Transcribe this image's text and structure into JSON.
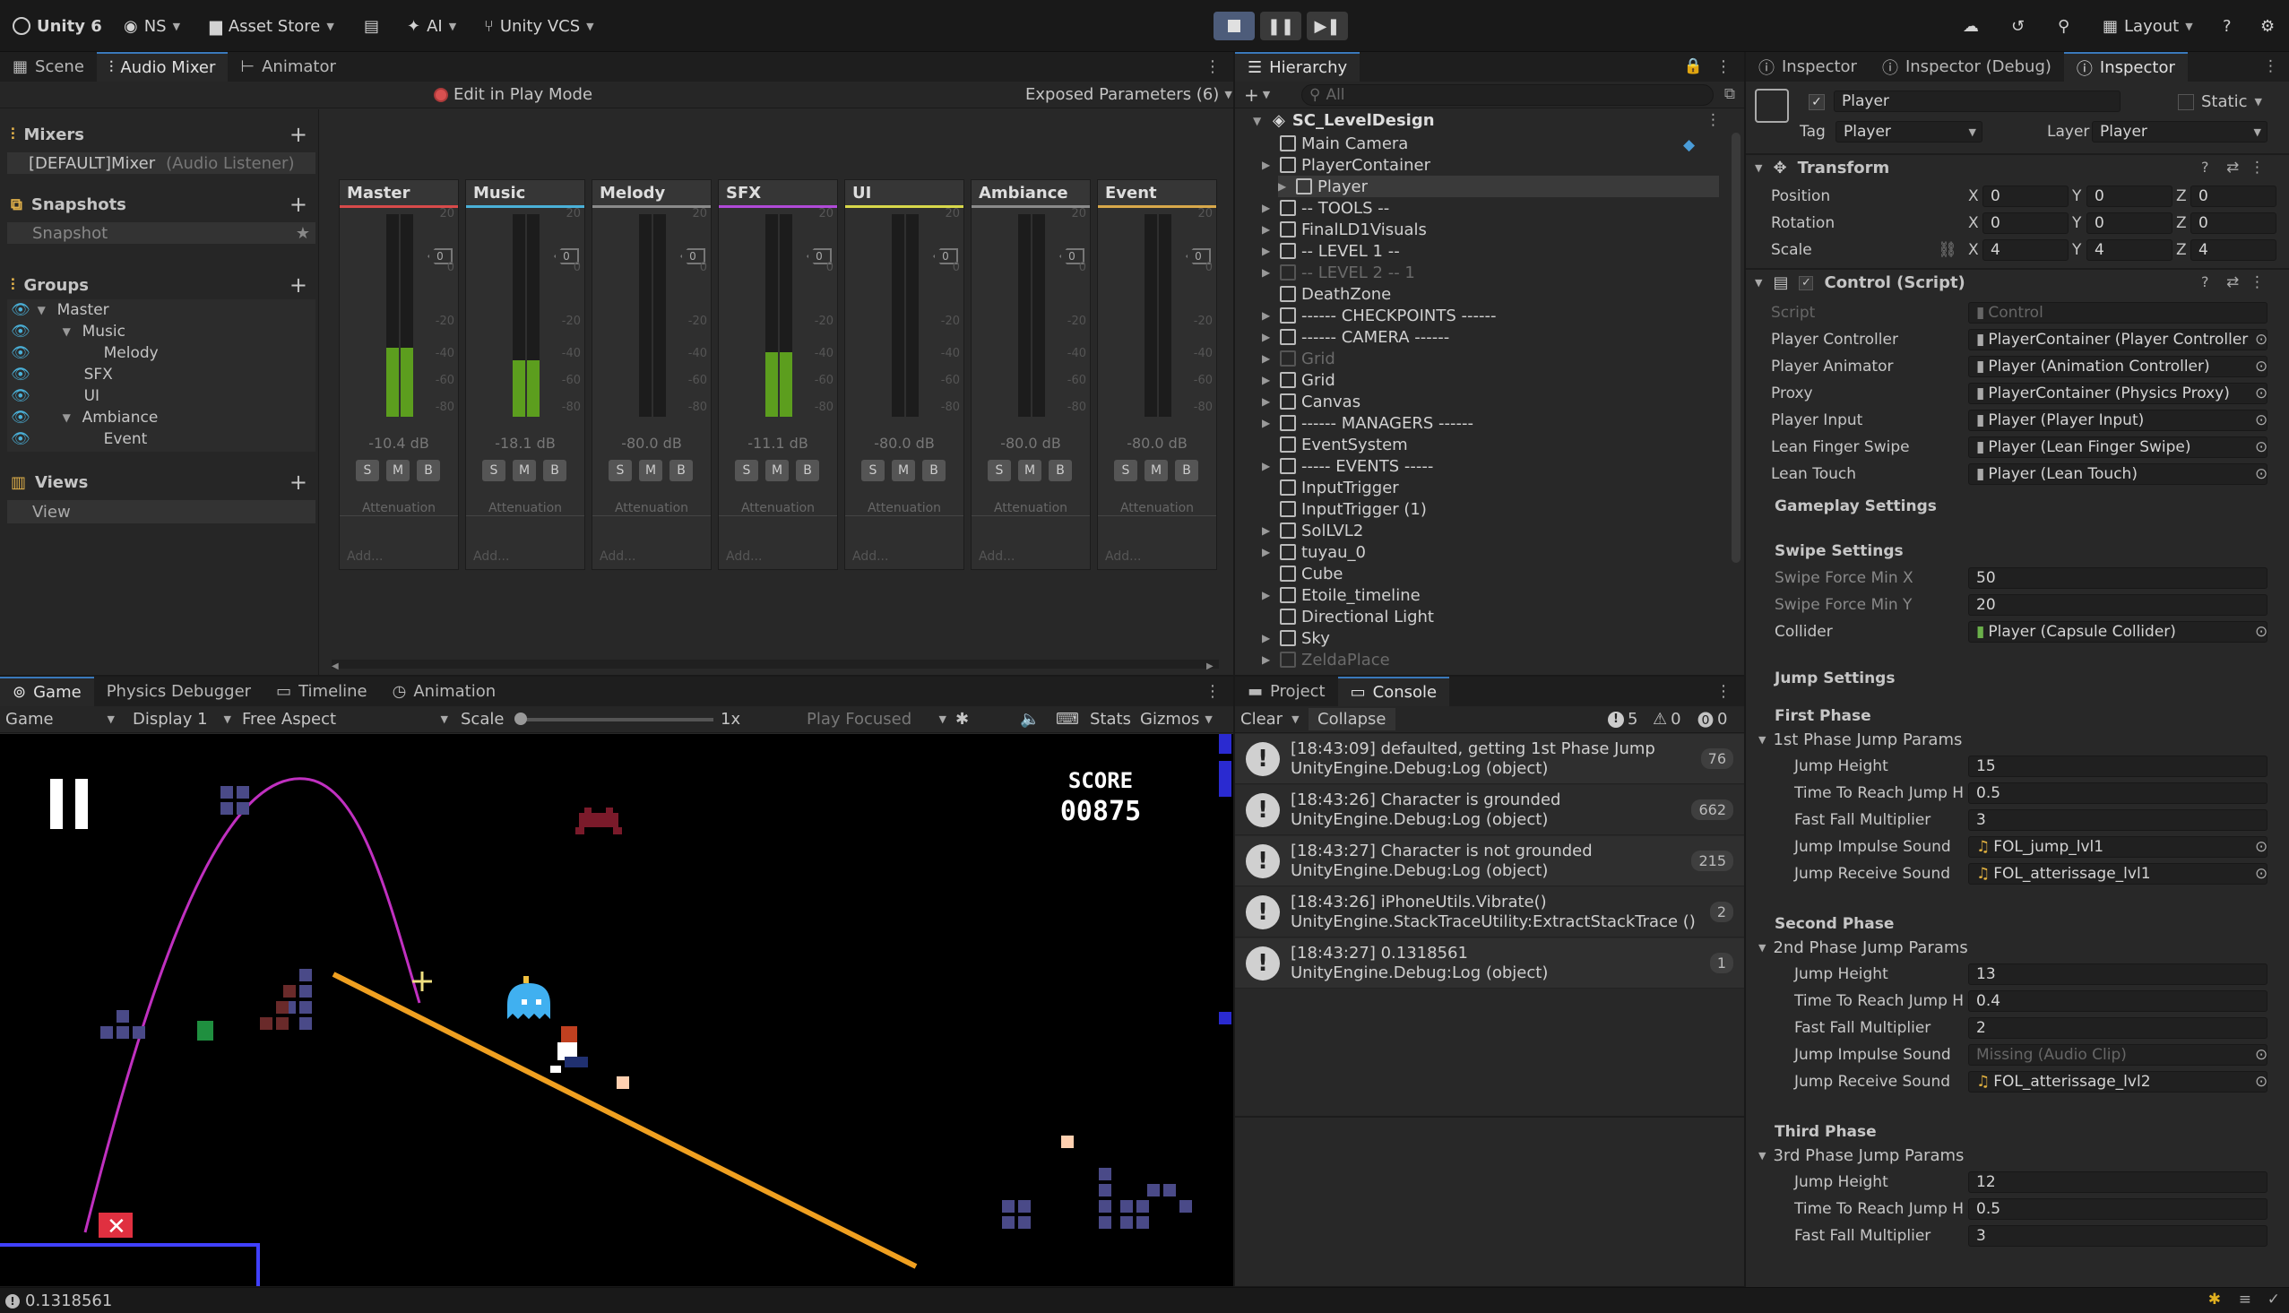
{
  "toolbar": {
    "app": "Unity 6",
    "account": "NS",
    "asset_store": "Asset Store",
    "ai": "AI",
    "vcs": "Unity VCS",
    "layout": "Layout"
  },
  "mixer_panel": {
    "tabs": [
      "Scene",
      "Audio Mixer",
      "Animator"
    ],
    "edit_play": "Edit in Play Mode",
    "exposed": "Exposed Parameters (6)",
    "mixers_title": "Mixers",
    "mixer_item": "[DEFAULT]Mixer",
    "mixer_item_note": "(Audio Listener)",
    "snapshots_title": "Snapshots",
    "snapshot_item": "Snapshot",
    "groups_title": "Groups",
    "groups": [
      "Master",
      "Music",
      "Melody",
      "SFX",
      "UI",
      "Ambiance",
      "Event"
    ],
    "views_title": "Views",
    "view_item": "View",
    "strips": [
      {
        "name": "Master",
        "db": "-10.4 dB",
        "level": 0.34,
        "color": "#d84a4a"
      },
      {
        "name": "Music",
        "db": "-18.1 dB",
        "level": 0.28,
        "color": "#4ab0d8"
      },
      {
        "name": "Melody",
        "db": "-80.0 dB",
        "level": 0.0,
        "color": "#8a8a8a"
      },
      {
        "name": "SFX",
        "db": "-11.1 dB",
        "level": 0.32,
        "color": "#b04ad8"
      },
      {
        "name": "UI",
        "db": "-80.0 dB",
        "level": 0.0,
        "color": "#d8d84a"
      },
      {
        "name": "Ambiance",
        "db": "-80.0 dB",
        "level": 0.0,
        "color": "#8a8a8a"
      },
      {
        "name": "Event",
        "db": "-80.0 dB",
        "level": 0.0,
        "color": "#d8a84a"
      }
    ],
    "scale_labels": [
      "20",
      "0",
      "-20",
      "-40",
      "-60",
      "-80"
    ],
    "fader_value": "0",
    "smb": [
      "S",
      "M",
      "B"
    ],
    "attenuation": "Attenuation",
    "add": "Add..."
  },
  "hierarchy": {
    "tab": "Hierarchy",
    "search_placeholder": "All",
    "scene": "SC_LevelDesign",
    "items": [
      {
        "name": "Main Camera",
        "indent": 0,
        "arrow": false,
        "dim": false
      },
      {
        "name": "PlayerContainer",
        "indent": 0,
        "arrow": true,
        "dim": false
      },
      {
        "name": "Player",
        "indent": 1,
        "arrow": true,
        "dim": false
      },
      {
        "name": "-- TOOLS --",
        "indent": 0,
        "arrow": true,
        "dim": false
      },
      {
        "name": "FinalLD1Visuals",
        "indent": 0,
        "arrow": true,
        "dim": false
      },
      {
        "name": "-- LEVEL 1 --",
        "indent": 0,
        "arrow": true,
        "dim": false
      },
      {
        "name": "-- LEVEL 2 -- 1",
        "indent": 0,
        "arrow": true,
        "dim": true
      },
      {
        "name": "DeathZone",
        "indent": 0,
        "arrow": false,
        "dim": false
      },
      {
        "name": "------ CHECKPOINTS ------",
        "indent": 0,
        "arrow": true,
        "dim": false
      },
      {
        "name": "------ CAMERA ------",
        "indent": 0,
        "arrow": true,
        "dim": false
      },
      {
        "name": "Grid",
        "indent": 0,
        "arrow": true,
        "dim": true
      },
      {
        "name": "Grid",
        "indent": 0,
        "arrow": true,
        "dim": false
      },
      {
        "name": "Canvas",
        "indent": 0,
        "arrow": true,
        "dim": false
      },
      {
        "name": "------ MANAGERS ------",
        "indent": 0,
        "arrow": true,
        "dim": false
      },
      {
        "name": "EventSystem",
        "indent": 0,
        "arrow": false,
        "dim": false
      },
      {
        "name": "----- EVENTS -----",
        "indent": 0,
        "arrow": true,
        "dim": false
      },
      {
        "name": "InputTrigger",
        "indent": 0,
        "arrow": false,
        "dim": false
      },
      {
        "name": "InputTrigger (1)",
        "indent": 0,
        "arrow": false,
        "dim": false
      },
      {
        "name": "SolLVL2",
        "indent": 0,
        "arrow": true,
        "dim": false
      },
      {
        "name": "tuyau_0",
        "indent": 0,
        "arrow": true,
        "dim": false
      },
      {
        "name": "Cube",
        "indent": 0,
        "arrow": false,
        "dim": false
      },
      {
        "name": "Etoile_timeline",
        "indent": 0,
        "arrow": true,
        "dim": false
      },
      {
        "name": "Directional Light",
        "indent": 0,
        "arrow": false,
        "dim": false
      },
      {
        "name": "Sky",
        "indent": 0,
        "arrow": true,
        "dim": false
      },
      {
        "name": "ZeldaPlace",
        "indent": 0,
        "arrow": true,
        "dim": true
      }
    ]
  },
  "game": {
    "tabs": [
      "Game",
      "Physics Debugger",
      "Timeline",
      "Animation"
    ],
    "mode": "Game",
    "display": "Display 1",
    "aspect": "Free Aspect",
    "scale_label": "Scale",
    "scale_value": "1x",
    "play_focused": "Play Focused",
    "stats": "Stats",
    "gizmos": "Gizmos",
    "score_label": "SCORE",
    "score_value": "00875"
  },
  "console": {
    "tabs": [
      "Project",
      "Console"
    ],
    "clear": "Clear",
    "collapse": "Collapse",
    "counts": [
      "5",
      "0",
      "0"
    ],
    "logs": [
      {
        "l1": "[18:43:09] defaulted, getting 1st Phase Jump",
        "l2": "UnityEngine.Debug:Log (object)",
        "count": "76"
      },
      {
        "l1": "[18:43:26] Character is grounded",
        "l2": "UnityEngine.Debug:Log (object)",
        "count": "662"
      },
      {
        "l1": "[18:43:27] Character is not grounded",
        "l2": "UnityEngine.Debug:Log (object)",
        "count": "215"
      },
      {
        "l1": "[18:43:26] iPhoneUtils.Vibrate()",
        "l2": "UnityEngine.StackTraceUtility:ExtractStackTrace ()",
        "count": "2"
      },
      {
        "l1": "[18:43:27] 0.1318561",
        "l2": "UnityEngine.Debug:Log (object)",
        "count": "1"
      }
    ]
  },
  "inspector": {
    "tabs": [
      "Inspector",
      "Inspector (Debug)",
      "Inspector"
    ],
    "object_name": "Player",
    "static_label": "Static",
    "tag_label": "Tag",
    "tag_value": "Player",
    "layer_label": "Layer",
    "layer_value": "Player",
    "transform_title": "Transform",
    "position_label": "Position",
    "rotation_label": "Rotation",
    "scale_label": "Scale",
    "position": [
      "0",
      "0",
      "0"
    ],
    "rotation": [
      "0",
      "0",
      "0"
    ],
    "scale": [
      "4",
      "4",
      "4"
    ],
    "axes": [
      "X",
      "Y",
      "Z"
    ],
    "control_title": "Control (Script)",
    "script_label": "Script",
    "script_value": "Control",
    "refs": [
      {
        "label": "Player Controller",
        "value": "PlayerContainer (Player Controller"
      },
      {
        "label": "Player Animator",
        "value": "Player (Animation Controller)"
      },
      {
        "label": "Proxy",
        "value": "PlayerContainer (Physics Proxy)"
      },
      {
        "label": "Player Input",
        "value": "Player (Player Input)"
      },
      {
        "label": "Lean Finger Swipe",
        "value": "Player (Lean Finger Swipe)"
      },
      {
        "label": "Lean Touch",
        "value": "Player (Lean Touch)"
      }
    ],
    "gameplay_settings": "Gameplay Settings",
    "swipe_settings": "Swipe Settings",
    "swipe_x_label": "Swipe Force Min X",
    "swipe_x": "50",
    "swipe_y_label": "Swipe Force Min Y",
    "swipe_y": "20",
    "collider_label": "Collider",
    "collider_value": "Player (Capsule Collider)",
    "jump_settings": "Jump Settings",
    "phases": [
      {
        "title": "First Phase",
        "params": "1st Phase Jump Params",
        "height": "15",
        "time": "0.5",
        "fall": "3",
        "impulse": "FOL_jump_lvl1",
        "receive": "FOL_atterissage_lvl1",
        "impulse_missing": false
      },
      {
        "title": "Second Phase",
        "params": "2nd Phase Jump Params",
        "height": "13",
        "time": "0.4",
        "fall": "2",
        "impulse": "Missing (Audio Clip)",
        "receive": "FOL_atterissage_lvl2",
        "impulse_missing": true
      },
      {
        "title": "Third Phase",
        "params": "3rd Phase Jump Params",
        "height": "12",
        "time": "0.5",
        "fall": "3"
      }
    ],
    "jump_height_label": "Jump Height",
    "time_label": "Time To Reach Jump H",
    "fall_label": "Fast Fall Multiplier",
    "impulse_label": "Jump Impulse Sound",
    "receive_label": "Jump Receive Sound"
  },
  "status_bar": {
    "message": "0.1318561"
  }
}
